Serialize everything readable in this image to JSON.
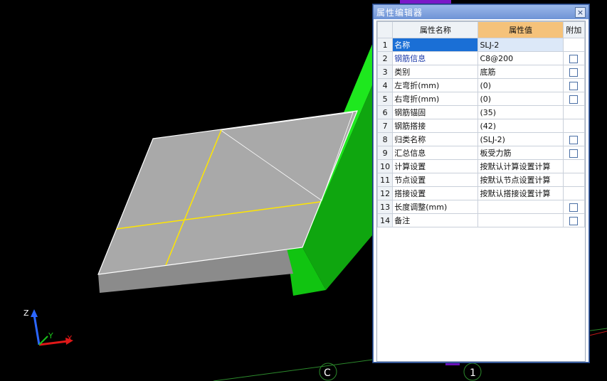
{
  "panel": {
    "title": "属性编辑器",
    "close_glyph": "×",
    "headers": {
      "name": "属性名称",
      "value": "属性值",
      "extra": "附加"
    },
    "rows": [
      {
        "num": "1",
        "name": "名称",
        "value": "SLJ-2",
        "checkbox": false,
        "selected": true,
        "blue": false
      },
      {
        "num": "2",
        "name": "钢筋信息",
        "value": "C8@200",
        "checkbox": true,
        "selected": false,
        "blue": true
      },
      {
        "num": "3",
        "name": "类别",
        "value": "底筋",
        "checkbox": true,
        "selected": false,
        "blue": false
      },
      {
        "num": "4",
        "name": "左弯折(mm)",
        "value": "(0)",
        "checkbox": true,
        "selected": false,
        "blue": false
      },
      {
        "num": "5",
        "name": "右弯折(mm)",
        "value": "(0)",
        "checkbox": true,
        "selected": false,
        "blue": false
      },
      {
        "num": "6",
        "name": "钢筋锚固",
        "value": "(35)",
        "checkbox": false,
        "selected": false,
        "blue": false
      },
      {
        "num": "7",
        "name": "钢筋搭接",
        "value": "(42)",
        "checkbox": false,
        "selected": false,
        "blue": false
      },
      {
        "num": "8",
        "name": "归类名称",
        "value": "(SLJ-2)",
        "checkbox": true,
        "selected": false,
        "blue": false
      },
      {
        "num": "9",
        "name": "汇总信息",
        "value": "板受力筋",
        "checkbox": true,
        "selected": false,
        "blue": false
      },
      {
        "num": "10",
        "name": "计算设置",
        "value": "按默认计算设置计算",
        "checkbox": false,
        "selected": false,
        "blue": false
      },
      {
        "num": "11",
        "name": "节点设置",
        "value": "按默认节点设置计算",
        "checkbox": false,
        "selected": false,
        "blue": false
      },
      {
        "num": "12",
        "name": "搭接设置",
        "value": "按默认搭接设置计算",
        "checkbox": false,
        "selected": false,
        "blue": false
      },
      {
        "num": "13",
        "name": "长度调整(mm)",
        "value": "",
        "checkbox": true,
        "selected": false,
        "blue": false
      },
      {
        "num": "14",
        "name": "备注",
        "value": "",
        "checkbox": true,
        "selected": false,
        "blue": false
      }
    ]
  },
  "viewport": {
    "axis_labels": {
      "z": "Z",
      "y": "Y",
      "x": "X"
    },
    "grid_markers": [
      "C",
      "1"
    ],
    "colors": {
      "slab": "#a9a9a9",
      "beam": "#14d414",
      "rebar": "#ffe600",
      "background": "#000000"
    }
  }
}
